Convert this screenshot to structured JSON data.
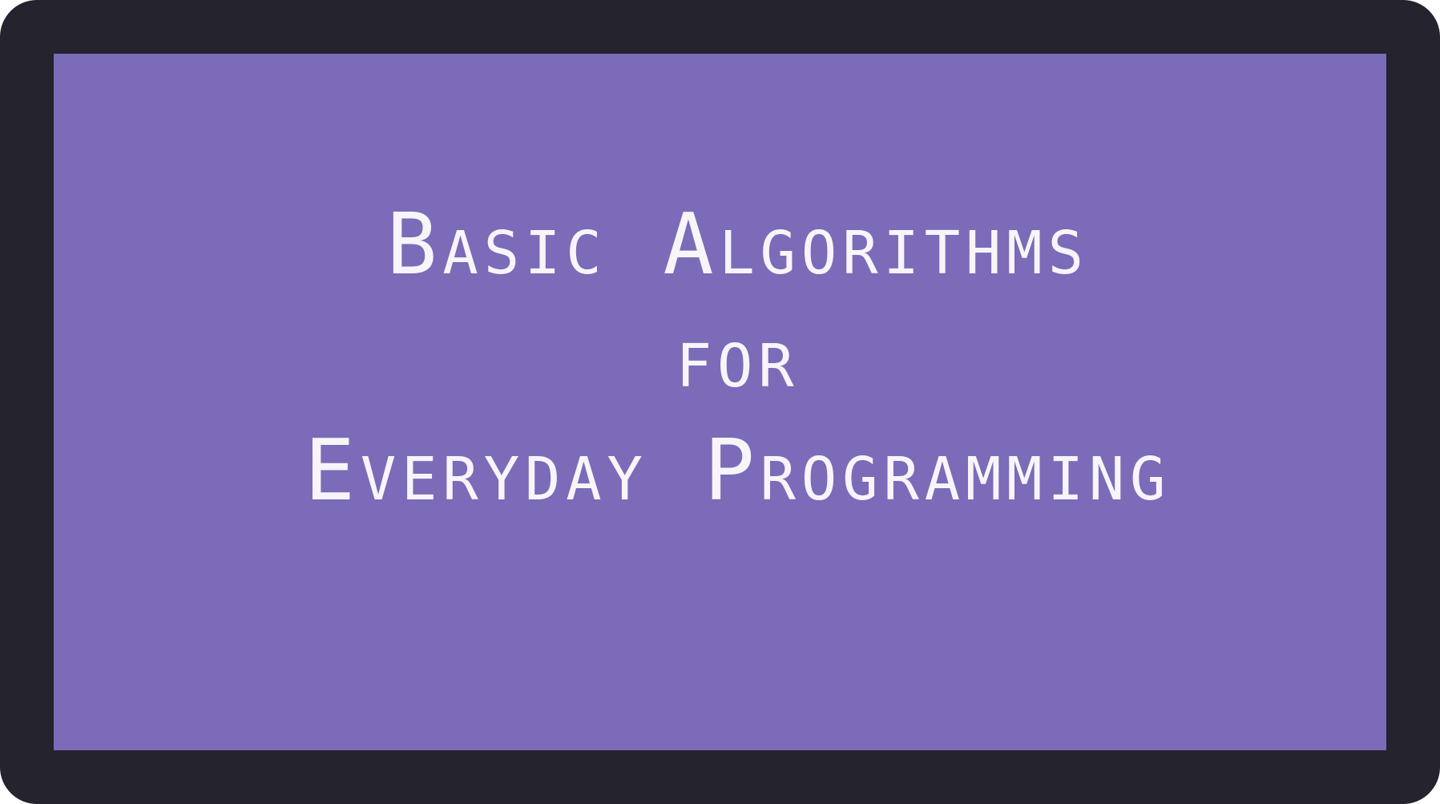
{
  "title": {
    "line1": "Basic Algorithms",
    "line2": "for",
    "line3": "Everyday Programming"
  },
  "colors": {
    "frame": "#25232d",
    "panel": "#7b6bb8",
    "text": "#f7f5f9"
  }
}
